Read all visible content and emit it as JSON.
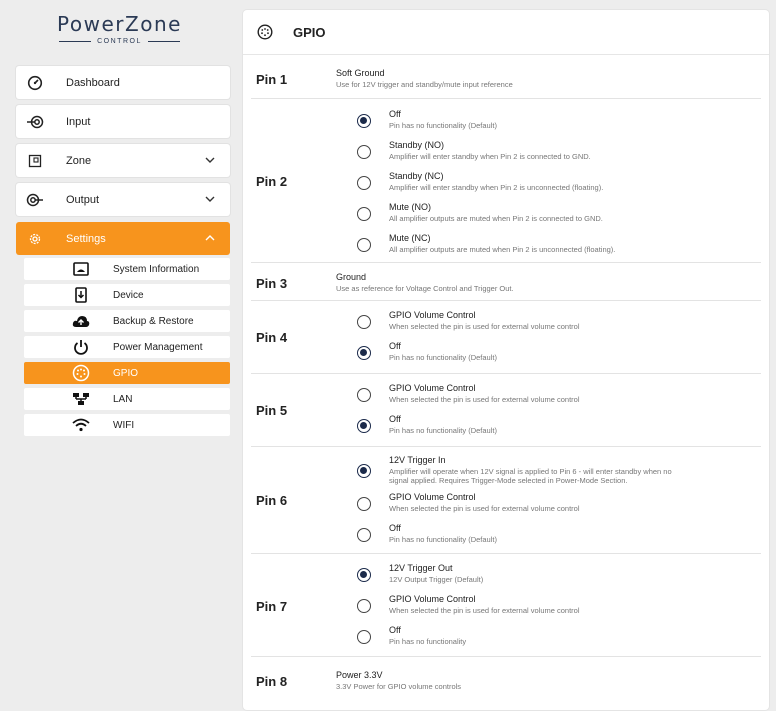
{
  "brand": {
    "name": "PowerZone",
    "subtitle": "CONTROL"
  },
  "nav": {
    "dashboard": "Dashboard",
    "input": "Input",
    "zone": "Zone",
    "output": "Output",
    "settings": "Settings"
  },
  "settings_menu": [
    {
      "label": "System Information",
      "icon": "monitor-icon"
    },
    {
      "label": "Device",
      "icon": "device-download-icon"
    },
    {
      "label": "Backup & Restore",
      "icon": "cloud-upload-icon"
    },
    {
      "label": "Power Management",
      "icon": "power-icon"
    },
    {
      "label": "GPIO",
      "icon": "gpio-connector-icon"
    },
    {
      "label": "LAN",
      "icon": "network-icon"
    },
    {
      "label": "WIFI",
      "icon": "wifi-icon"
    }
  ],
  "colors": {
    "accent": "#f7941d",
    "radio": "#1b2a4a",
    "brand": "#2b3a55"
  },
  "panel": {
    "title": "GPIO"
  },
  "pins": {
    "pin1": {
      "label": "Pin 1",
      "title": "Soft Ground",
      "desc": "Use for 12V trigger and standby/mute input reference"
    },
    "pin2": {
      "label": "Pin 2",
      "options": [
        {
          "title": "Off",
          "desc": "Pin has no functionality (Default)",
          "checked": true
        },
        {
          "title": "Standby (NO)",
          "desc": "Amplifier will enter standby when Pin 2 is connected to GND.",
          "checked": false
        },
        {
          "title": "Standby (NC)",
          "desc": "Amplifier will enter standby when Pin 2 is unconnected (floating).",
          "checked": false
        },
        {
          "title": "Mute (NO)",
          "desc": "All amplifier outputs are muted when Pin 2 is connected to GND.",
          "checked": false
        },
        {
          "title": "Mute (NC)",
          "desc": "All amplifier outputs are muted when Pin 2 is unconnected (floating).",
          "checked": false
        }
      ]
    },
    "pin3": {
      "label": "Pin 3",
      "title": "Ground",
      "desc": "Use as reference for Voltage Control and Trigger Out."
    },
    "pin4": {
      "label": "Pin 4",
      "options": [
        {
          "title": "GPIO Volume Control",
          "desc": "When selected the pin is used for external volume control",
          "checked": false
        },
        {
          "title": "Off",
          "desc": "Pin has no functionality (Default)",
          "checked": true
        }
      ]
    },
    "pin5": {
      "label": "Pin 5",
      "options": [
        {
          "title": "GPIO Volume Control",
          "desc": "When selected the pin is used for external volume control",
          "checked": false
        },
        {
          "title": "Off",
          "desc": "Pin has no functionality (Default)",
          "checked": true
        }
      ]
    },
    "pin6": {
      "label": "Pin 6",
      "options": [
        {
          "title": "12V Trigger In",
          "desc1": "Amplifier will operate when 12V signal is applied to Pin 6 - will enter standby when no",
          "desc2": "signal applied. Requires Trigger-Mode selected in Power-Mode Section.",
          "checked": true
        },
        {
          "title": "GPIO Volume Control",
          "desc": "When selected the pin is used for external volume control",
          "checked": false
        },
        {
          "title": "Off",
          "desc": "Pin has no functionality (Default)",
          "checked": false
        }
      ]
    },
    "pin7": {
      "label": "Pin 7",
      "options": [
        {
          "title": "12V Trigger Out",
          "desc": "12V Output Trigger (Default)",
          "checked": true
        },
        {
          "title": "GPIO Volume Control",
          "desc": "When selected the pin is used for external volume control",
          "checked": false
        },
        {
          "title": "Off",
          "desc": "Pin has no functionality",
          "checked": false
        }
      ]
    },
    "pin8": {
      "label": "Pin 8",
      "title": "Power 3.3V",
      "desc": "3.3V Power for GPIO volume controls"
    }
  }
}
